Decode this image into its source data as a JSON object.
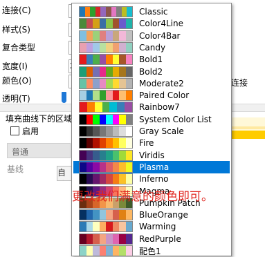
{
  "form": {
    "labels": [
      "连接(C)",
      "样式(S)",
      "复合类型",
      "宽度(I)",
      "颜色(O)",
      "透明(T)"
    ],
    "fill_text": "填充曲线下的区域",
    "enable_label": "启用",
    "dropdown_value": "普通",
    "baseline_label": "基线",
    "auto_button": "自动",
    "width_value": "2",
    "right_text": "连接"
  },
  "popup": {
    "items": [
      {
        "name": "Classic",
        "colors": [
          "#1f77b4",
          "#ff7f0e",
          "#2ca02c",
          "#d62728",
          "#9467bd",
          "#8c564b",
          "#e377c2",
          "#7f7f7f",
          "#bcbd22",
          "#17becf"
        ]
      },
      {
        "name": "Color4Line",
        "colors": [
          "#4a8a3a",
          "#c44e52",
          "#d4a017",
          "#3a6ea5",
          "#8bc34a",
          "#a0522d",
          "#6a5acd",
          "#20b2aa"
        ]
      },
      {
        "name": "Color4Bar",
        "colors": [
          "#7fbfe0",
          "#f2a35c",
          "#9bd17a",
          "#e08080",
          "#b9a0d8",
          "#c9a77c",
          "#f2b8d8",
          "#c0c0c0"
        ]
      },
      {
        "name": "Candy",
        "colors": [
          "#e9a0b0",
          "#c0a0e0",
          "#a0c8e8",
          "#b8e0a0",
          "#f0d080",
          "#f0a070",
          "#d0b0d0",
          "#90d0c0"
        ]
      },
      {
        "name": "Bold1",
        "colors": [
          "#e41a1c",
          "#377eb8",
          "#4daf4a",
          "#984ea3",
          "#ff7f00",
          "#ffff33",
          "#a65628",
          "#f781bf"
        ]
      },
      {
        "name": "Bold2",
        "colors": [
          "#1b9e77",
          "#d95f02",
          "#7570b3",
          "#e7298a",
          "#66a61e",
          "#e6ab02",
          "#a6761d",
          "#666666"
        ]
      },
      {
        "name": "Moderate2",
        "colors": [
          "#66c2a5",
          "#fc8d62",
          "#8da0cb",
          "#e78ac3",
          "#a6d854",
          "#ffd92f",
          "#e5c494",
          "#b3b3b3"
        ]
      },
      {
        "name": "Paired Color",
        "colors": [
          "#a6cee3",
          "#1f78b4",
          "#b2df8a",
          "#33a02c",
          "#fb9a99",
          "#e31a1c",
          "#fdbf6f",
          "#ff7f00"
        ]
      },
      {
        "name": "Rainbow7",
        "colors": [
          "#e41a1c",
          "#ff7f00",
          "#ffff33",
          "#4daf4a",
          "#00bcd4",
          "#377eb8",
          "#984ea3"
        ]
      },
      {
        "name": "System Color List",
        "colors": [
          "#000000",
          "#ff0000",
          "#00ff00",
          "#0000ff",
          "#00ffff",
          "#ff00ff",
          "#ffff00",
          "#808080"
        ]
      },
      {
        "name": "Gray Scale",
        "colors": [
          "#000000",
          "#333333",
          "#555555",
          "#777777",
          "#999999",
          "#bbbbbb",
          "#dddddd",
          "#ffffff"
        ]
      },
      {
        "name": "Fire",
        "colors": [
          "#000000",
          "#5a0000",
          "#b01000",
          "#e04000",
          "#ff8000",
          "#ffc000",
          "#ffff60",
          "#ffffe0"
        ]
      },
      {
        "name": "Viridis",
        "colors": [
          "#440154",
          "#46327e",
          "#365c8d",
          "#277f8e",
          "#1fa187",
          "#4ac16d",
          "#a0da39",
          "#fde725"
        ]
      },
      {
        "name": "Plasma",
        "colors": [
          "#0d0887",
          "#5302a3",
          "#8b0aa5",
          "#b83289",
          "#db5c68",
          "#f48849",
          "#febd2a",
          "#f0f921"
        ]
      },
      {
        "name": "Inferno",
        "colors": [
          "#000004",
          "#280b54",
          "#65156e",
          "#9f2a63",
          "#d44842",
          "#f57d15",
          "#fac127",
          "#fcffa4"
        ]
      },
      {
        "name": "Magma",
        "colors": [
          "#000004",
          "#221150",
          "#5f187f",
          "#982d80",
          "#d3436e",
          "#f8765c",
          "#febb81",
          "#fcfdbf"
        ]
      },
      {
        "name": "Pumpkin Patch",
        "colors": [
          "#6b2d0f",
          "#a8441a",
          "#d8652a",
          "#f29549",
          "#f7b96e",
          "#c9a06a",
          "#7a8a3a",
          "#3e5a2a"
        ]
      },
      {
        "name": "BlueOrange",
        "colors": [
          "#053061",
          "#2166ac",
          "#4393c3",
          "#92c5de",
          "#f4a582",
          "#d6604d",
          "#e08214",
          "#fdb863"
        ]
      },
      {
        "name": "Warming",
        "colors": [
          "#2c7bb6",
          "#abd9e9",
          "#ffffbf",
          "#fdae61",
          "#d7191c",
          "#ef8a62",
          "#f7c59f",
          "#67a9cf"
        ]
      },
      {
        "name": "RedPurple",
        "colors": [
          "#67001f",
          "#b2182b",
          "#d6604d",
          "#f4a582",
          "#c994c7",
          "#df65b0",
          "#980043",
          "#54278f"
        ]
      },
      {
        "name": "配色1",
        "colors": [
          "#8dd3c7",
          "#ffffb3",
          "#bebada",
          "#fb8072",
          "#80b1d3",
          "#fdb462",
          "#b3de69",
          "#fccde5"
        ]
      }
    ],
    "selected_index": 13
  },
  "overlay": {
    "text": "更改我们满意的颜色即可。",
    "color": "#e0231c"
  },
  "colors": {
    "selection": "#0078d7",
    "accent_yellow": "#ffcc00"
  }
}
